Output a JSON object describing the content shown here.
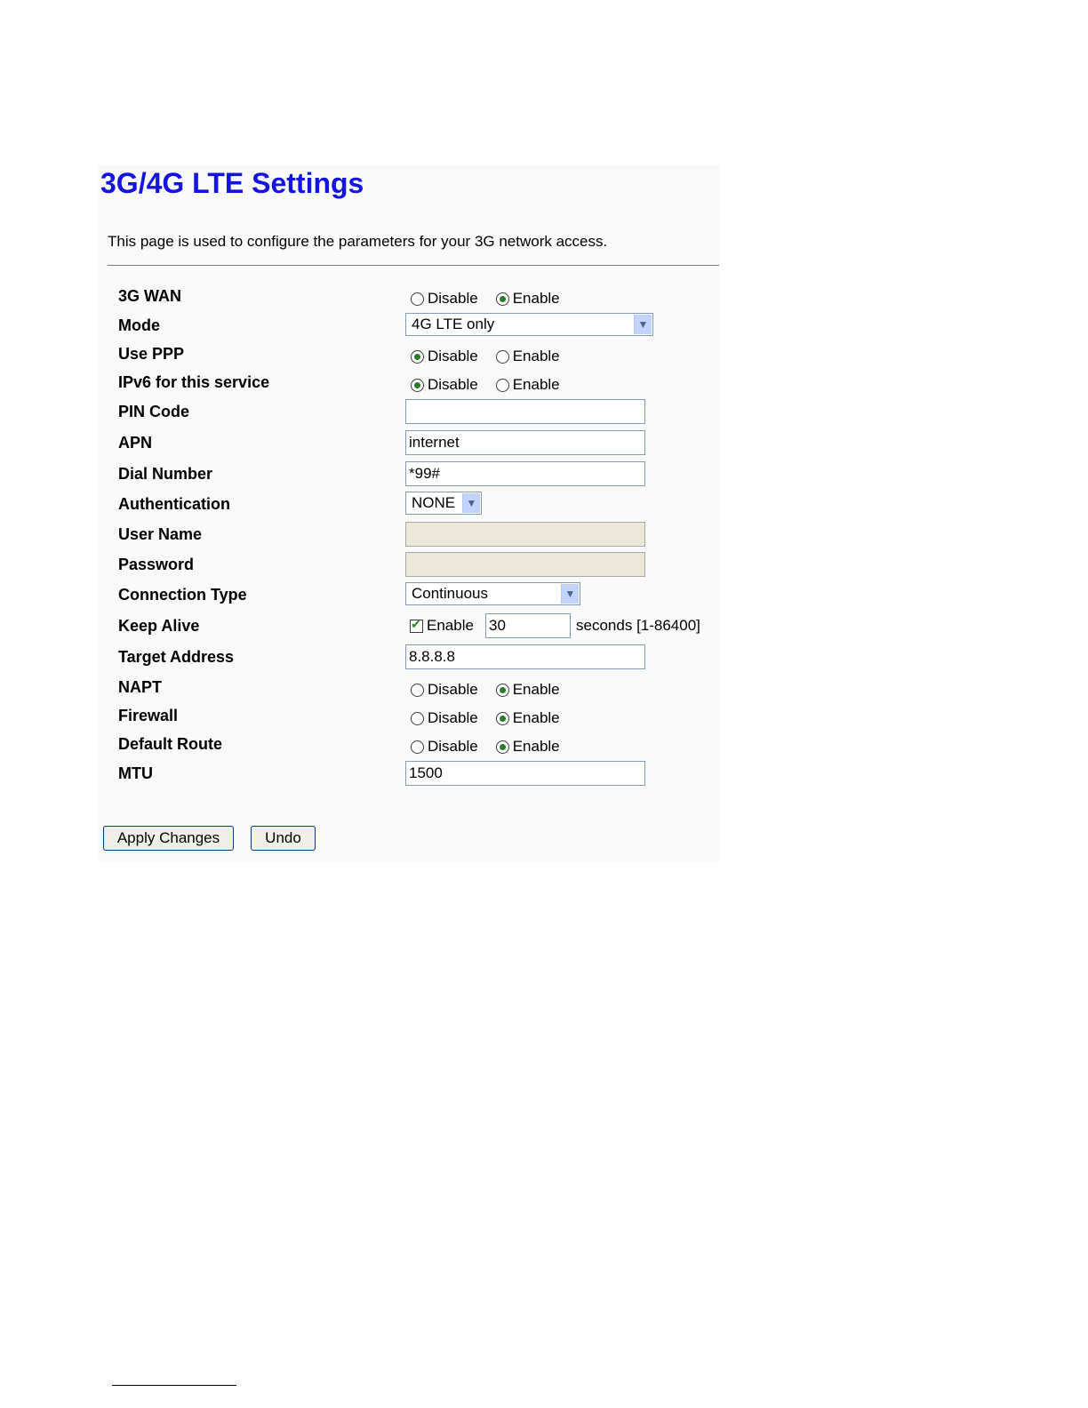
{
  "page": {
    "title": "3G/4G LTE Settings",
    "description": "This page is used to configure the parameters for your 3G network access."
  },
  "fields": {
    "wan": {
      "label": "3G WAN",
      "options": [
        "Disable",
        "Enable"
      ],
      "selected": "Enable"
    },
    "mode": {
      "label": "Mode",
      "value": "4G LTE only"
    },
    "use_ppp": {
      "label": "Use PPP",
      "options": [
        "Disable",
        "Enable"
      ],
      "selected": "Disable"
    },
    "ipv6": {
      "label": "IPv6 for this service",
      "options": [
        "Disable",
        "Enable"
      ],
      "selected": "Disable"
    },
    "pin_code": {
      "label": "PIN Code",
      "value": ""
    },
    "apn": {
      "label": "APN",
      "value": "internet"
    },
    "dial_number": {
      "label": "Dial Number",
      "value": "*99#"
    },
    "authentication": {
      "label": "Authentication",
      "value": "NONE"
    },
    "user_name": {
      "label": "User Name",
      "value": ""
    },
    "password": {
      "label": "Password",
      "value": ""
    },
    "connection_type": {
      "label": "Connection Type",
      "value": "Continuous"
    },
    "keep_alive": {
      "label": "Keep Alive",
      "checkbox_label": "Enable",
      "checked": true,
      "value": "30",
      "unit": "seconds",
      "range": "[1-86400]"
    },
    "target_address": {
      "label": "Target Address",
      "value": "8.8.8.8"
    },
    "napt": {
      "label": "NAPT",
      "options": [
        "Disable",
        "Enable"
      ],
      "selected": "Enable"
    },
    "firewall": {
      "label": "Firewall",
      "options": [
        "Disable",
        "Enable"
      ],
      "selected": "Enable"
    },
    "default_route": {
      "label": "Default Route",
      "options": [
        "Disable",
        "Enable"
      ],
      "selected": "Enable"
    },
    "mtu": {
      "label": "MTU",
      "value": "1500"
    }
  },
  "buttons": {
    "apply": "Apply Changes",
    "undo": "Undo"
  },
  "colors": {
    "title": "#1414e0",
    "disabled_field": "#ebe8d9",
    "radio_dot": "#2a7a2a"
  }
}
